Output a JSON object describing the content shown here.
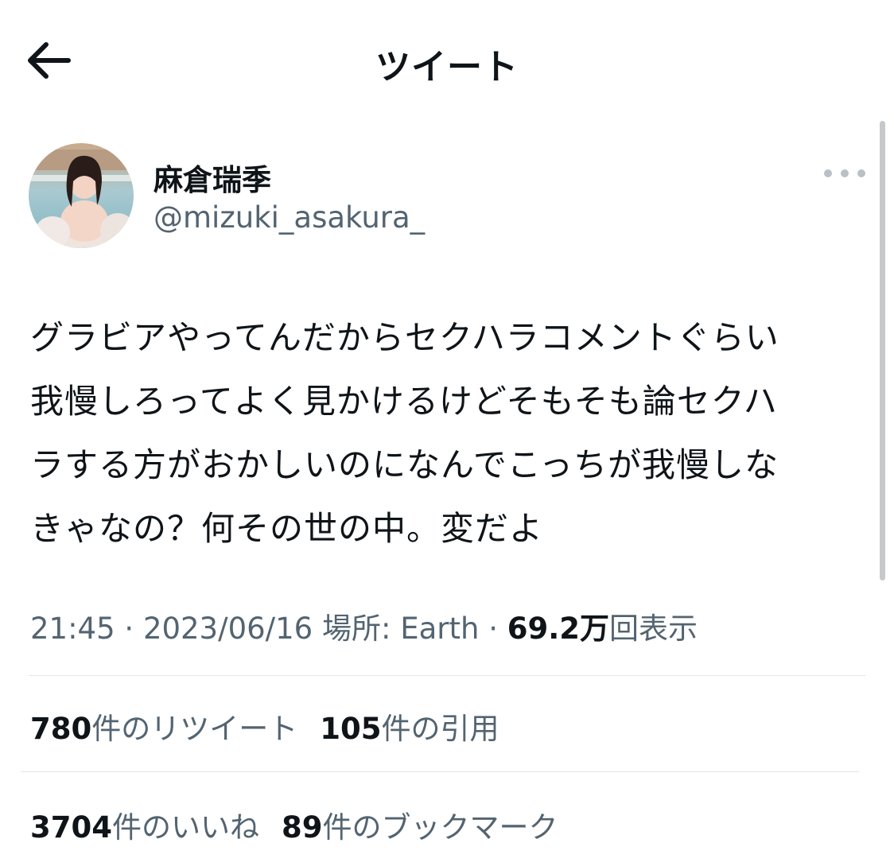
{
  "header": {
    "title": "ツイート",
    "back_icon": "arrow-left-icon"
  },
  "author": {
    "name": "麻倉瑞季",
    "handle": "@mizuki_asakura_",
    "more_icon": "more-horizontal-icon"
  },
  "tweet": {
    "text": "グラビアやってんだからセクハラコメントぐらい\n我慢しろってよく見かけるけどそもそも論セクハ\nラする方がおかしいのになんでこっちが我慢しな\nきゃなの？何その世の中。変だよ"
  },
  "meta": {
    "time": "21:45",
    "sep1": " · ",
    "date": "2023/06/16",
    "location_label": " 場所: ",
    "location": "Earth",
    "sep2": " · ",
    "views": "69.2万",
    "views_label": "回表示"
  },
  "stats": {
    "retweets": {
      "count": "780",
      "label": "件のリツイート"
    },
    "quotes": {
      "count": "105",
      "label": "件の引用"
    },
    "likes": {
      "count": "3704",
      "label": "件のいいね"
    },
    "bookmarks": {
      "count": "89",
      "label": "件のブックマーク"
    }
  },
  "colors": {
    "text": "#0f1419",
    "secondary": "#536471",
    "divider": "#e1e6ea"
  }
}
